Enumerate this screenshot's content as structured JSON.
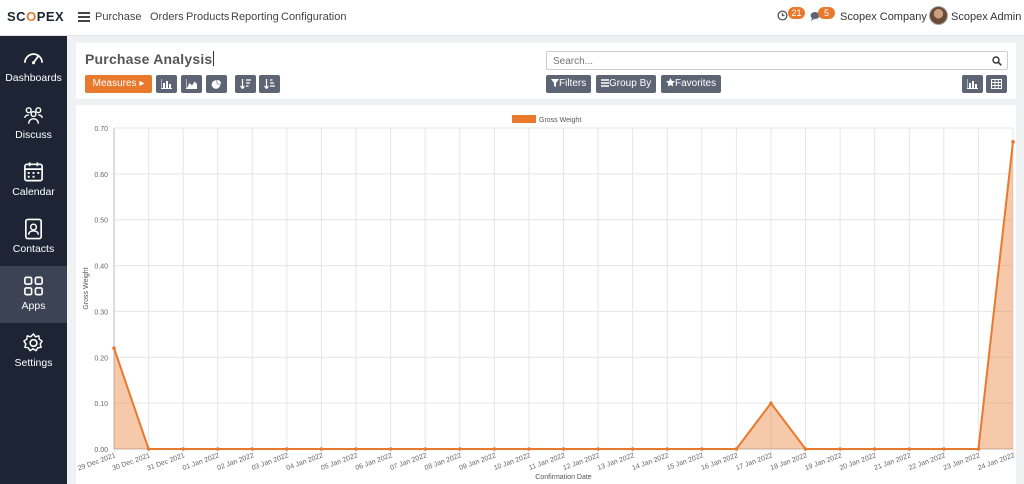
{
  "topbar": {
    "logo_pre": "SC",
    "logo_o": "O",
    "logo_post": "PEX",
    "app_name": "Purchase",
    "menu": [
      "Orders",
      "Products",
      "Reporting",
      "Configuration"
    ],
    "activity_count": "21",
    "message_count": "5",
    "company": "Scopex Company",
    "user": "Scopex Admin",
    "accent_color": "#e8792d"
  },
  "sidebar": {
    "items": [
      {
        "label": "Dashboards",
        "icon": "gauge-icon"
      },
      {
        "label": "Discuss",
        "icon": "people-icon"
      },
      {
        "label": "Calendar",
        "icon": "calendar-icon"
      },
      {
        "label": "Contacts",
        "icon": "contacts-icon"
      },
      {
        "label": "Apps",
        "icon": "apps-grid-icon",
        "active": true
      },
      {
        "label": "Settings",
        "icon": "gear-icon"
      }
    ]
  },
  "control": {
    "title": "Purchase Analysis",
    "measures_label": "Measures ▸",
    "search_placeholder": "Search...",
    "filters_label": "Filters",
    "groupby_label": "Group By",
    "favorites_label": "Favorites"
  },
  "chart_data": {
    "type": "area",
    "legend": [
      "Gross Weight"
    ],
    "legend_position": "top-center",
    "xlabel": "Confirmation Date",
    "ylabel": "Gross Weight",
    "ylim": [
      0,
      0.7
    ],
    "yticks": [
      "0.00",
      "0.10",
      "0.20",
      "0.30",
      "0.40",
      "0.50",
      "0.60",
      "0.70"
    ],
    "grid": true,
    "color": "#e8792d",
    "categories": [
      "29 Dec 2021",
      "30 Dec 2021",
      "31 Dec 2021",
      "01 Jan 2022",
      "02 Jan 2022",
      "03 Jan 2022",
      "04 Jan 2022",
      "05 Jan 2022",
      "06 Jan 2022",
      "07 Jan 2022",
      "08 Jan 2022",
      "09 Jan 2022",
      "10 Jan 2022",
      "11 Jan 2022",
      "12 Jan 2022",
      "13 Jan 2022",
      "14 Jan 2022",
      "15 Jan 2022",
      "16 Jan 2022",
      "17 Jan 2022",
      "18 Jan 2022",
      "19 Jan 2022",
      "20 Jan 2022",
      "21 Jan 2022",
      "22 Jan 2022",
      "23 Jan 2022",
      "24 Jan 2022"
    ],
    "series": [
      {
        "name": "Gross Weight",
        "values": [
          0.22,
          0,
          0,
          0,
          0,
          0,
          0,
          0,
          0,
          0,
          0,
          0,
          0,
          0,
          0,
          0,
          0,
          0,
          0,
          0.1,
          0,
          0,
          0,
          0,
          0,
          0,
          0.67
        ]
      }
    ]
  }
}
